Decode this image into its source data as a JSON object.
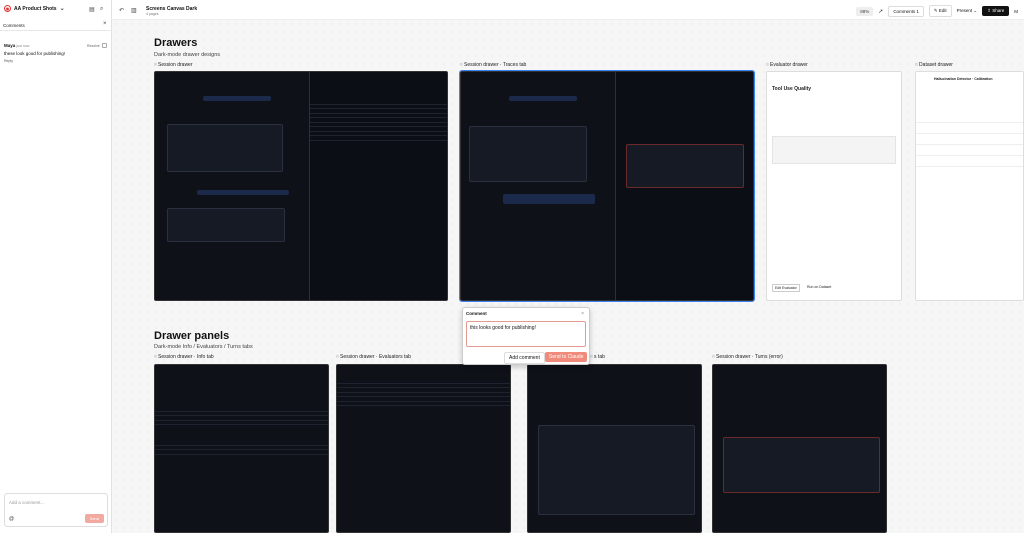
{
  "sidebar": {
    "workspace": "AA Product Shots",
    "comments_heading": "Comments",
    "comment": {
      "author": "Maya",
      "time": "just now",
      "text": "these look good for publishing!",
      "reply": "Reply",
      "resolve": "Resolve"
    },
    "composer": {
      "placeholder": "Add a comment…",
      "send": "Send",
      "attach": "@"
    }
  },
  "topbar": {
    "title": "Screens Canvas Dark",
    "subtitle": "4 pages",
    "zoom": "88%",
    "comments": "Comments",
    "comments_count": "1",
    "edit": "Edit",
    "present": "Present",
    "share": "Share",
    "avatar": "M"
  },
  "sections": {
    "drawers": {
      "title": "Drawers",
      "subtitle": "Dark-mode drawer designs"
    },
    "panels": {
      "title": "Drawer panels",
      "subtitle": "Dark-mode Info / Evaluators / Turns tabs"
    }
  },
  "artboards_top": [
    "Session drawer",
    "Session drawer · Traces tab",
    "Evaluator drawer",
    "Dataset drawer"
  ],
  "artboards_bottom": [
    "Session drawer · Info tab",
    "Session drawer · Evaluators tab",
    "s tab",
    "Session drawer · Turns (error)"
  ],
  "evaluator": {
    "title": "Tool Use Quality",
    "edit": "Edit Evaluator",
    "run": "Run on Dataset"
  },
  "dataset": {
    "title": "Hallucination Detector · Calibration"
  },
  "comment_popup": {
    "heading": "Comment",
    "text": "this looks good for publishing!",
    "add": "Add comment",
    "send": "Send to Claude"
  }
}
